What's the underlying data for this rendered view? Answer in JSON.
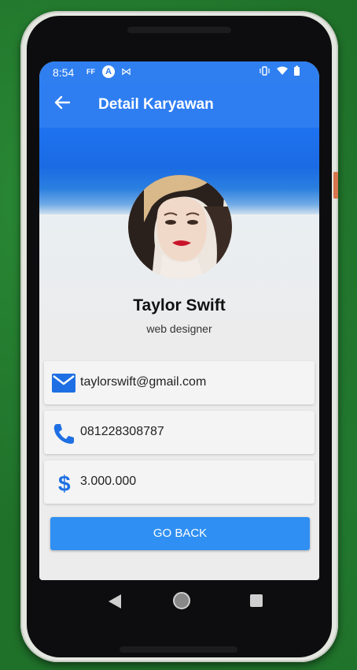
{
  "status_bar": {
    "time": "8:54",
    "notif_ff": "FF",
    "notif_a": "A",
    "notif_m": "⋈",
    "right_icons": "▯▾▮"
  },
  "app_bar": {
    "back_icon": "arrow-left-icon",
    "title": "Detail Karyawan"
  },
  "profile": {
    "name": "Taylor Swift",
    "job": "web designer"
  },
  "contact_cards": [
    {
      "icon": "mail-icon",
      "value": "taylorswift@gmail.com"
    },
    {
      "icon": "phone-icon",
      "value": "081228308787"
    },
    {
      "icon": "dollar-icon",
      "value": "3.000.000"
    }
  ],
  "button": {
    "label": "GO BACK"
  },
  "colors": {
    "primary": "#2e7ef2",
    "button": "#2f8ff2",
    "icon": "#1e6fe3"
  }
}
